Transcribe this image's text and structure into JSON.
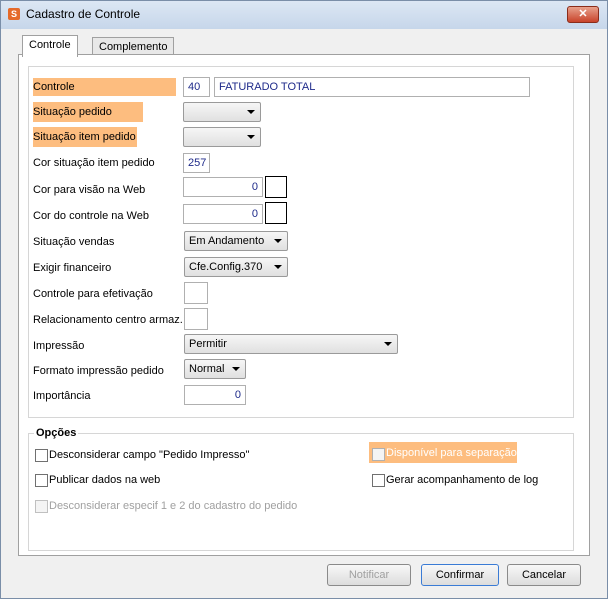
{
  "window": {
    "title": "Cadastro de Controle",
    "close_label": "✕",
    "icon_glyph": "S"
  },
  "tabs": [
    {
      "label": "Controle"
    },
    {
      "label": "Complemento"
    }
  ],
  "fields": {
    "controle": {
      "label": "Controle",
      "code": "40",
      "name": "FATURADO TOTAL"
    },
    "situacao_pedido": {
      "label": "Situação pedido",
      "value": ""
    },
    "situacao_item_pedido": {
      "label": "Situação item pedido",
      "value": ""
    },
    "cor_situacao_item_pedido": {
      "label": "Cor situação item pedido",
      "value": "257"
    },
    "cor_visao_web": {
      "label": "Cor para visão na Web",
      "value": "0"
    },
    "cor_controle_web": {
      "label": "Cor do controle na Web",
      "value": "0"
    },
    "situacao_vendas": {
      "label": "Situação vendas",
      "value": "Em Andamento"
    },
    "exigir_financeiro": {
      "label": "Exigir financeiro",
      "value": "Cfe.Config.370"
    },
    "controle_efetivacao": {
      "label": "Controle para efetivação",
      "value": ""
    },
    "relacionamento_centro": {
      "label": "Relacionamento centro armaz.",
      "value": ""
    },
    "impressao": {
      "label": "Impressão",
      "value": "Permitir"
    },
    "formato_impressao": {
      "label": "Formato impressão pedido",
      "value": "Normal"
    },
    "importancia": {
      "label": "Importância",
      "value": "0"
    }
  },
  "options": {
    "title": "Opções",
    "desconsiderar_impresso": "Desconsiderar campo \"Pedido Impresso\"",
    "disponivel_separacao": "Disponível para separação",
    "publicar_web": "Publicar dados na web",
    "gerar_log": "Gerar acompanhamento de log",
    "desconsiderar_especif": "Desconsiderar especif 1 e 2 do cadastro do pedido"
  },
  "buttons": {
    "notificar": "Notificar",
    "confirmar": "Confirmar",
    "cancelar": "Cancelar"
  },
  "colors": {
    "highlight": "#fdbd7f",
    "value_text": "#1e2a8a"
  }
}
